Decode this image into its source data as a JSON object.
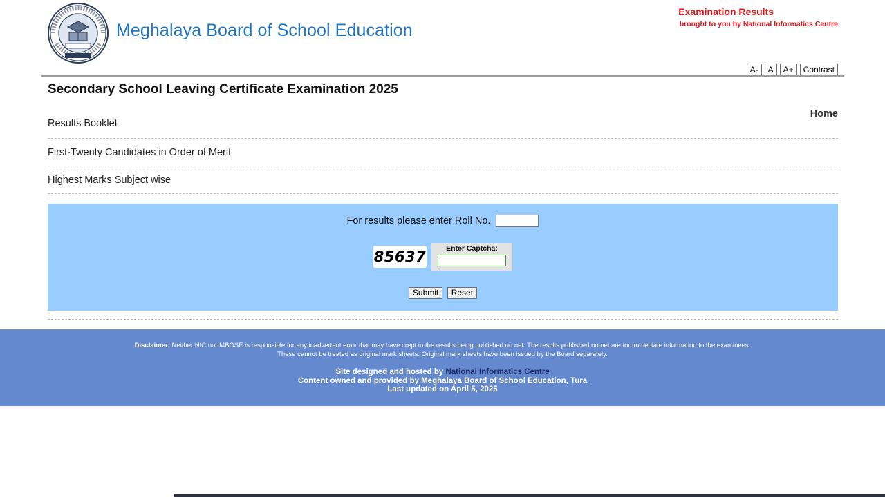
{
  "header": {
    "board_name": "Meghalaya Board of School Education",
    "logo_icon": "mbose-seal-logo",
    "exam_results": "Examination Results",
    "brought_by": "brought to you by National Informatics Centre"
  },
  "accessibility": {
    "decrease": "A-",
    "normal": "A",
    "increase": "A+",
    "contrast": "Contrast"
  },
  "page": {
    "heading": "Secondary School Leaving Certificate Examination 2025",
    "home": "Home"
  },
  "menu": {
    "items": [
      {
        "label": "Results Booklet"
      },
      {
        "label": "First-Twenty Candidates in Order of Merit"
      },
      {
        "label": "Highest Marks Subject wise"
      }
    ]
  },
  "form": {
    "roll_label": "For results please enter Roll No.",
    "roll_value": "",
    "captcha_code": "85637",
    "captcha_label": "Enter Captcha:",
    "captcha_value": "",
    "submit": "Submit",
    "reset": "Reset"
  },
  "footer": {
    "disclaimer_title": "Disclaimer:",
    "disclaimer_text": " Neither NIC nor MBOSE is responsible for any inadvertent error that may have crept in the results being published on net. The results published on net are for immediate information to the examinees.",
    "disclaimer_text2": "These cannot be treated as original mark sheets. Original mark sheets have been issued by the Board separately.",
    "hosted_prefix": "Site designed and hosted by ",
    "hosted_link": "National Informatics Centre",
    "content_owner": "Content owned and provided by Meghalaya Board of School Education, Tura",
    "last_updated": "Last updated on April 5, 2025"
  },
  "colors": {
    "title_blue": "#1f74bf",
    "header_red": "#e8121b",
    "panel_blue": "#99ccff",
    "footer_blue": "#6589ce"
  }
}
